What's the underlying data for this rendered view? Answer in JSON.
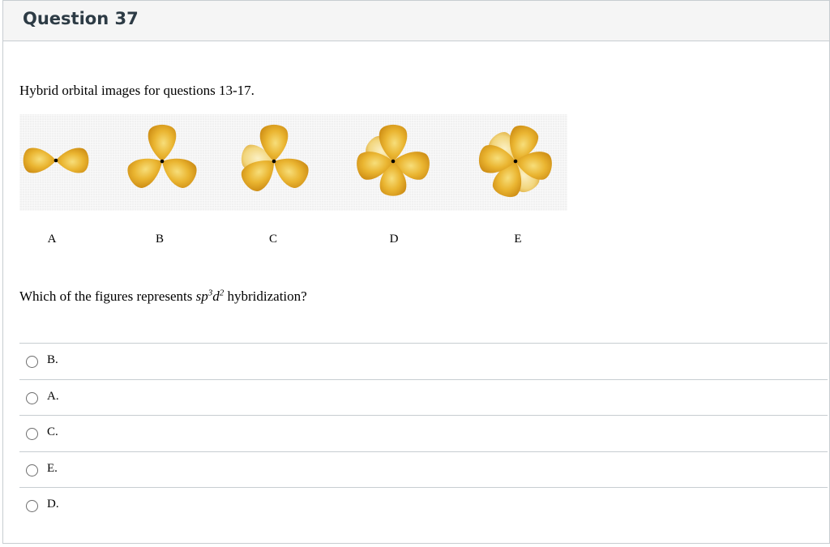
{
  "question": {
    "title": "Question 37",
    "intro": "Hybrid orbital images for questions 13-17.",
    "figure_labels": [
      "A",
      "B",
      "C",
      "D",
      "E"
    ],
    "prompt_before": "Which of the figures represents ",
    "prompt_term": "sp",
    "prompt_sup1": "3",
    "prompt_term2": "d",
    "prompt_sup2": "2",
    "prompt_after": " hybridization?"
  },
  "answers": [
    {
      "label": "B."
    },
    {
      "label": "A."
    },
    {
      "label": "C."
    },
    {
      "label": "E."
    },
    {
      "label": "D."
    }
  ],
  "colors": {
    "lobe": "#e9ad2a",
    "lobe_highlight": "#f7de7a",
    "nucleus": "#000000"
  }
}
